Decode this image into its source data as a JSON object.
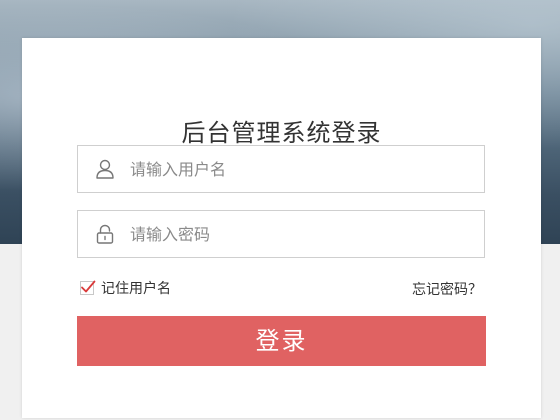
{
  "login": {
    "title": "后台管理系统登录",
    "username_placeholder": "请输入用户名",
    "password_placeholder": "请输入密码",
    "remember_label": "记住用户名",
    "remember_checked": true,
    "forgot_label": "忘记密码？",
    "submit_label": "登录"
  },
  "icons": {
    "username": "user-icon",
    "password": "lock-icon",
    "remember": "checkmark-icon"
  },
  "colors": {
    "button": "#e06262",
    "checkmark": "#d93a3a",
    "title": "#333333",
    "placeholder": "#8a8a8a",
    "field_border": "#cfcfcf"
  }
}
